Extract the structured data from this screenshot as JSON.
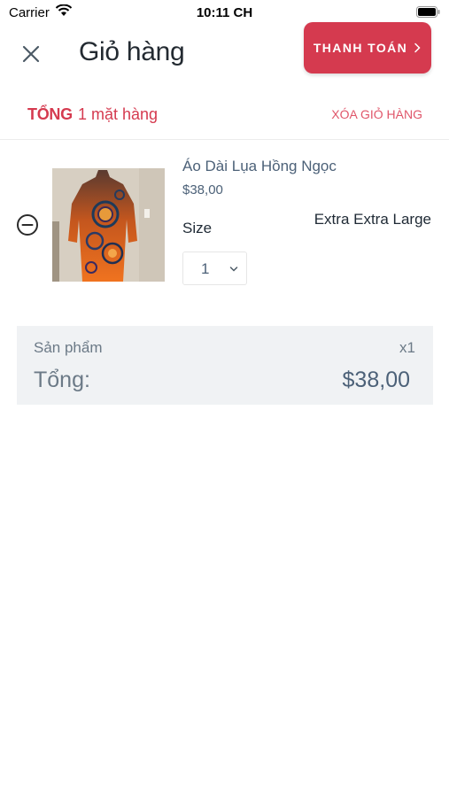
{
  "status_bar": {
    "carrier": "Carrier",
    "time": "10:11 CH"
  },
  "header": {
    "title": "Giỏ hàng",
    "checkout_label": "THANH TOÁN"
  },
  "summary": {
    "total_label": "TỔNG",
    "item_count": "1 mặt hàng",
    "clear_cart": "XÓA GIỎ HÀNG"
  },
  "cart_items": [
    {
      "name": "Áo Dài Lụa Hồng Ngọc",
      "price": "$38,00",
      "size_label": "Size",
      "size_value": "Extra Extra Large",
      "quantity": "1"
    }
  ],
  "totals": {
    "products_label": "Sản phẩm",
    "products_qty": "x1",
    "grand_label": "Tổng:",
    "grand_value": "$38,00"
  },
  "icons": [
    "wifi-icon",
    "battery-icon",
    "close-icon",
    "chevron-right-icon",
    "remove-circle-icon",
    "chevron-down-icon"
  ],
  "colors": {
    "accent": "#d53a4f",
    "text_muted": "#4c6178",
    "panel_bg": "#f0f2f4"
  }
}
